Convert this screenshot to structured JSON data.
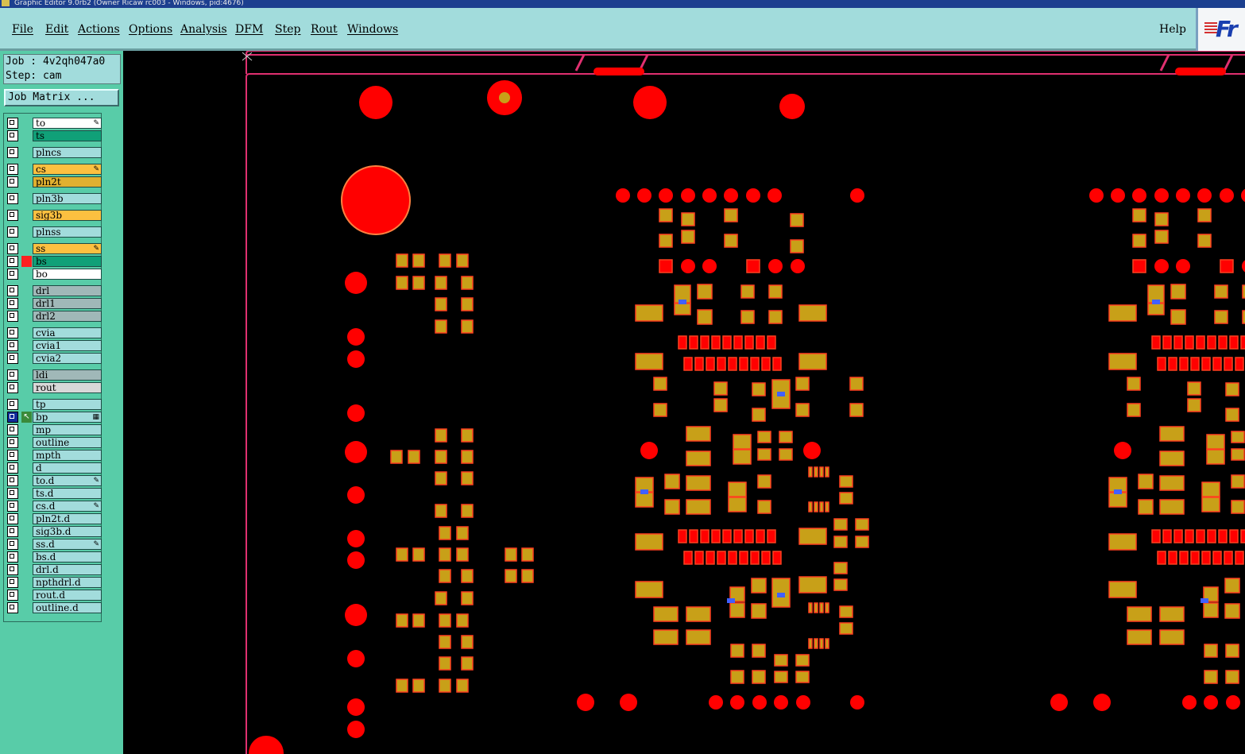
{
  "window": {
    "title": "Graphic Editor 9.0rb2 (Owner Ricaw rc003 - Windows, pid:4676)"
  },
  "menubar": {
    "items": [
      "File",
      "Edit",
      "Actions",
      "Options",
      "Analysis",
      "DFM",
      "Step",
      "Rout",
      "Windows"
    ],
    "help": "Help",
    "logo": "Fr"
  },
  "job": {
    "job_line": "Job : 4v2qh047a0",
    "step_line": "Step: cam"
  },
  "job_matrix_button": "Job Matrix ...",
  "layers": [
    {
      "name": "to",
      "color": "#ffffff",
      "sym": "✎"
    },
    {
      "name": "ts",
      "color": "#10a078",
      "sym": ""
    },
    {
      "name": "plncs",
      "color": "#a2dcdc",
      "sym": ""
    },
    {
      "name": "cs",
      "color": "#fcc040",
      "sym": "✎"
    },
    {
      "name": "pln2t",
      "color": "#e0b030",
      "sym": ""
    },
    {
      "name": "pln3b",
      "color": "#a2dcdc",
      "sym": ""
    },
    {
      "name": "sig3b",
      "color": "#fcc040",
      "sym": ""
    },
    {
      "name": "plnss",
      "color": "#a2dcdc",
      "sym": ""
    },
    {
      "name": "ss",
      "color": "#fcc040",
      "sym": "✎"
    },
    {
      "name": "bs",
      "color": "#10a078",
      "sym": "",
      "mark": "red"
    },
    {
      "name": "bo",
      "color": "#ffffff",
      "sym": ""
    },
    {
      "name": "drl",
      "color": "#a0b8b8",
      "sym": ""
    },
    {
      "name": "drl1",
      "color": "#a0b8b8",
      "sym": ""
    },
    {
      "name": "drl2",
      "color": "#a0b8b8",
      "sym": ""
    },
    {
      "name": "cvia",
      "color": "#a2dcdc",
      "sym": ""
    },
    {
      "name": "cvia1",
      "color": "#a2dcdc",
      "sym": ""
    },
    {
      "name": "cvia2",
      "color": "#a2dcdc",
      "sym": ""
    },
    {
      "name": "ldi",
      "color": "#a0b8b8",
      "sym": ""
    },
    {
      "name": "rout",
      "color": "#d8d8d8",
      "sym": ""
    },
    {
      "name": "tp",
      "color": "#a2dcdc",
      "sym": ""
    },
    {
      "name": "bp",
      "color": "#a2dcdc",
      "sym": "▦",
      "mark": "arrow",
      "selected": true
    },
    {
      "name": "mp",
      "color": "#a2dcdc",
      "sym": ""
    },
    {
      "name": "outline",
      "color": "#a2dcdc",
      "sym": ""
    },
    {
      "name": "mpth",
      "color": "#a2dcdc",
      "sym": ""
    },
    {
      "name": "d",
      "color": "#a2dcdc",
      "sym": ""
    },
    {
      "name": "to.d",
      "color": "#a2dcdc",
      "sym": "✎"
    },
    {
      "name": "ts.d",
      "color": "#a2dcdc",
      "sym": ""
    },
    {
      "name": "cs.d",
      "color": "#a2dcdc",
      "sym": "✎"
    },
    {
      "name": "pln2t.d",
      "color": "#a2dcdc",
      "sym": ""
    },
    {
      "name": "sig3b.d",
      "color": "#a2dcdc",
      "sym": ""
    },
    {
      "name": "ss.d",
      "color": "#a2dcdc",
      "sym": "✎"
    },
    {
      "name": "bs.d",
      "color": "#a2dcdc",
      "sym": ""
    },
    {
      "name": "drl.d",
      "color": "#a2dcdc",
      "sym": ""
    },
    {
      "name": "npthdrl.d",
      "color": "#a2dcdc",
      "sym": ""
    },
    {
      "name": "rout.d",
      "color": "#a2dcdc",
      "sym": ""
    },
    {
      "name": "outline.d",
      "color": "#a2dcdc",
      "sym": ""
    }
  ],
  "colors": {
    "pad_red": "#ff0000",
    "pad_gold": "#c8a018",
    "pad_outline": "#ff4020",
    "board_outline": "#e03070",
    "via_blue": "#4060ff"
  }
}
